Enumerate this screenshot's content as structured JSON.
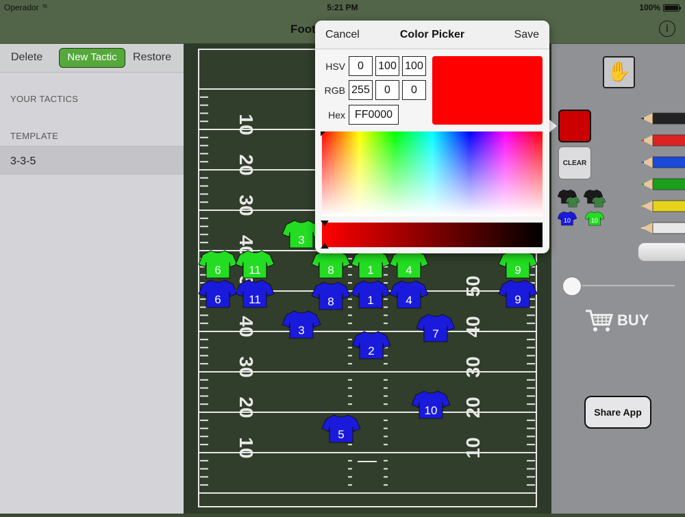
{
  "status": {
    "carrier": "Operador",
    "time": "5:21 PM",
    "battery": "100%"
  },
  "nav": {
    "title": "Foot"
  },
  "sidebar": {
    "toolbar": {
      "delete": "Delete",
      "new_tactic": "New Tactic",
      "restore": "Restore"
    },
    "section_your_tactics": "YOUR TACTICS",
    "section_template": "TEMPLATE",
    "template_items": [
      "3-3-5"
    ]
  },
  "field": {
    "yard_labels_left": [
      "10",
      "20",
      "30",
      "40",
      "50",
      "40",
      "30",
      "20",
      "10"
    ],
    "yard_labels_right": [
      "50",
      "40",
      "30",
      "20",
      "10"
    ],
    "green_players": [
      "6",
      "11",
      "3",
      "8",
      "1",
      "4",
      "9"
    ],
    "blue_players": [
      "6",
      "11",
      "8",
      "1",
      "4",
      "9",
      "3",
      "7",
      "2",
      "10",
      "5"
    ],
    "colors": {
      "grass": "#2e3a29",
      "green_jersey": "#22dd22",
      "blue_jersey": "#1a1adc"
    }
  },
  "right_panel": {
    "clear_label": "CLEAR",
    "buy_label": "BUY",
    "share_label": "Share App",
    "mini_jerseys": [
      "10",
      "10"
    ],
    "selected_color": "#cc0000",
    "pencil_colors": [
      "#222222",
      "#dd2222",
      "#1b49d8",
      "#1b9e1b",
      "#e6d21a",
      "#e8e8e8"
    ]
  },
  "color_picker": {
    "cancel": "Cancel",
    "title": "Color Picker",
    "save": "Save",
    "hsv_label": "HSV",
    "hsv": [
      "0",
      "100",
      "100"
    ],
    "rgb_label": "RGB",
    "rgb": [
      "255",
      "0",
      "0"
    ],
    "hex_label": "Hex",
    "hex": "FF0000",
    "preview_color": "#ff0000"
  }
}
